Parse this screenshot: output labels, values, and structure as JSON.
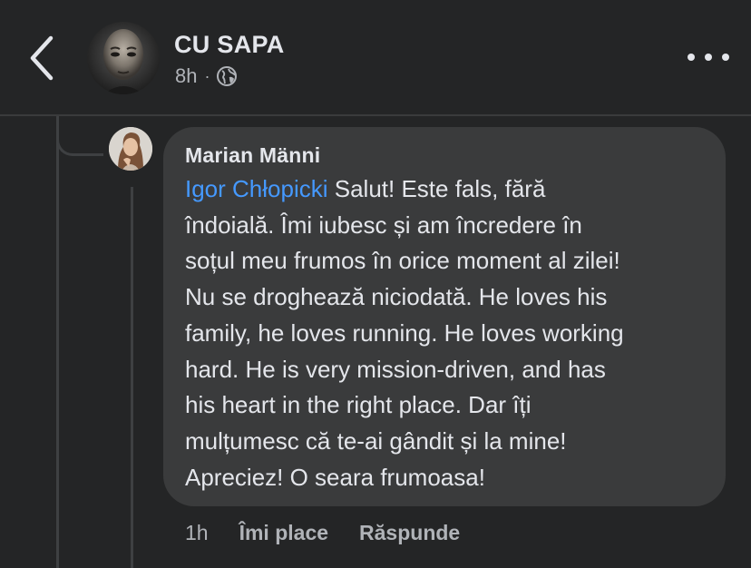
{
  "header": {
    "back_icon": "chevron-left-icon",
    "author": "CU SAPA",
    "time": "8h",
    "separator": "·",
    "privacy_icon": "globe-icon",
    "more_icon": "more-horizontal-icon"
  },
  "comment": {
    "author": "Marian Männi",
    "mention": "Igor Chłopicki",
    "lines": [
      " Salut! Este fals, fără",
      "îndoială. Îmi iubesc și am încredere în",
      "soțul meu frumos în orice moment al zilei!",
      "Nu se droghează niciodată. He loves his",
      "family, he loves running. He loves working",
      "hard. He is very mission-driven, and has",
      "his heart in the right place. Dar îți",
      "mulțumesc că te-ai gândit și la mine!",
      "Apreciez! O seara frumoasa!"
    ],
    "time": "1h",
    "like_label": "Îmi place",
    "reply_label": "Răspunde"
  },
  "colors": {
    "background": "#242526",
    "bubble": "#3a3b3c",
    "mention": "#4599ff",
    "secondary_text": "#b0b3b8",
    "primary_text": "#e4e6eb"
  }
}
